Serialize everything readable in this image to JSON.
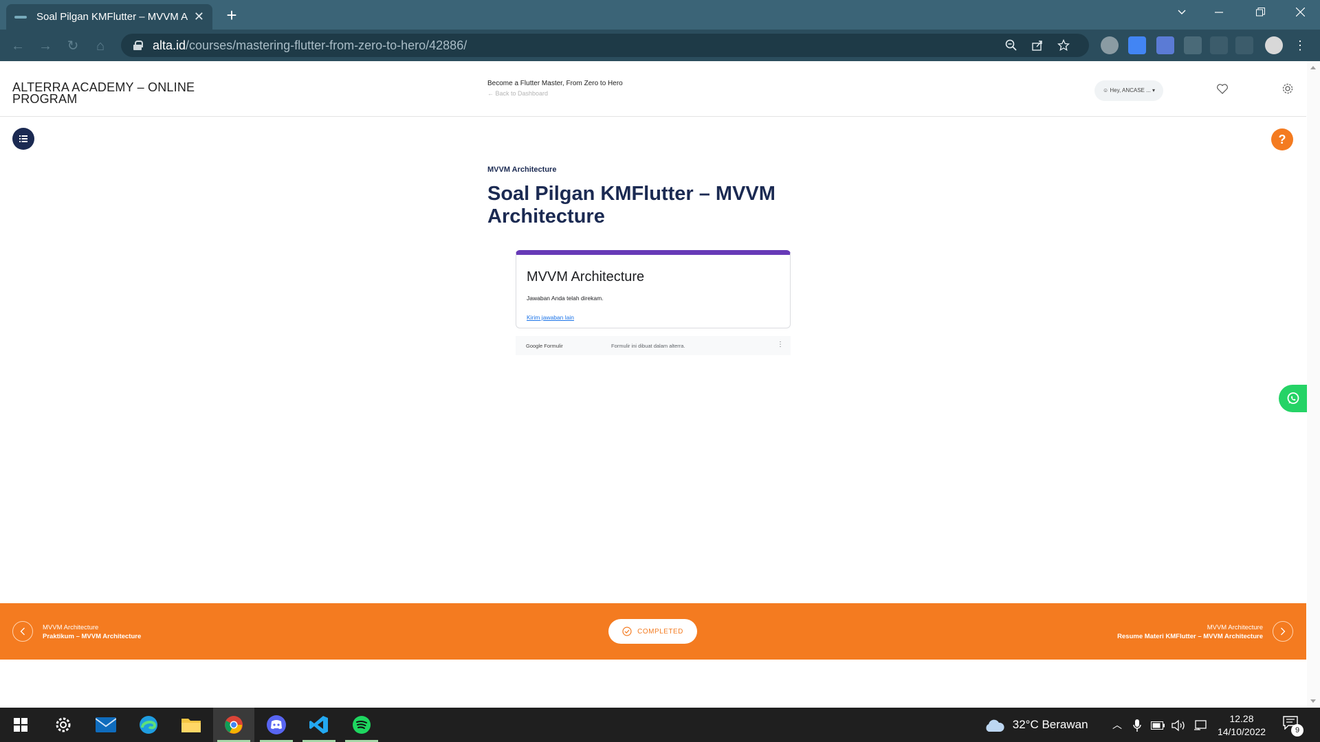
{
  "browser": {
    "tab_title": "Soal Pilgan KMFlutter – MVVM Architecture",
    "tab_close": "✕",
    "new_tab": "+",
    "url_host": "alta.id",
    "url_path": "/courses/mastering-flutter-from-zero-to-hero/42886/"
  },
  "header": {
    "site_title": "ALTERRA ACADEMY – ONLINE PROGRAM",
    "course_name": "Become a Flutter Master, From Zero to Hero",
    "back_link": "Back to Dashboard",
    "user_greeting": "Hey, ANCASE ..."
  },
  "content": {
    "section_label": "MVVM Architecture",
    "lesson_title": "Soal Pilgan KMFlutter – MVVM Architecture",
    "help_label": "?"
  },
  "form": {
    "title": "MVVM Architecture",
    "message": "Jawaban Anda telah direkam.",
    "link": "Kirim jawaban lain",
    "footer_brand": "Google Formulir",
    "footer_note": "Formulir ini dibuat dalam alterra.",
    "footer_menu": "⋮"
  },
  "bottom_nav": {
    "prev_section": "MVVM Architecture",
    "prev_title": "Praktikum – MVVM Architecture",
    "status": "COMPLETED",
    "next_section": "MVVM Architecture",
    "next_title": "Resume Materi KMFlutter – MVVM Architecture"
  },
  "taskbar": {
    "weather": "32°C  Berawan",
    "time": "12.28",
    "date": "14/10/2022",
    "notifications": "9"
  },
  "colors": {
    "accent_orange": "#f47b20",
    "navy": "#1b2a52",
    "form_purple": "#673ab7",
    "whatsapp_green": "#25d366"
  }
}
